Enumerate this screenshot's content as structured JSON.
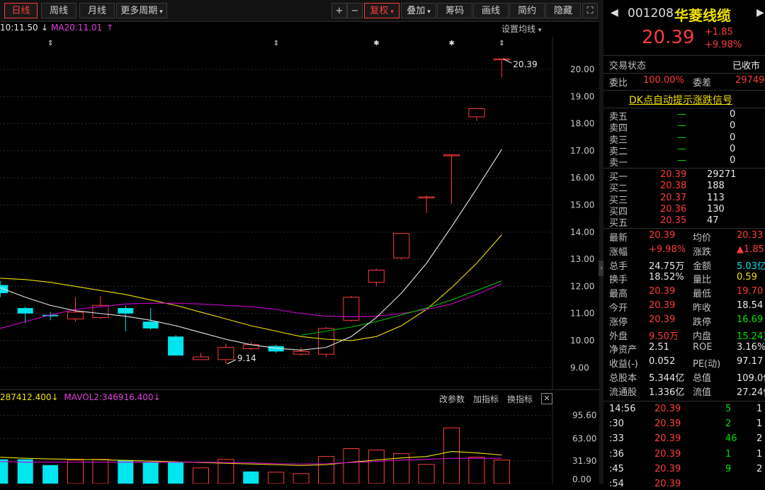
{
  "toolbar": {
    "tabs": [
      {
        "label": "日线",
        "active": true
      },
      {
        "label": "周线",
        "active": false
      },
      {
        "label": "月线",
        "active": false
      },
      {
        "label": "更多周期",
        "active": false
      }
    ],
    "right_buttons": [
      {
        "label": "+"
      },
      {
        "label": "−"
      },
      {
        "label": "复权",
        "active": true
      },
      {
        "label": "叠加"
      },
      {
        "label": "筹码"
      },
      {
        "label": "画线"
      },
      {
        "label": "简约"
      },
      {
        "label": "隐藏"
      }
    ]
  },
  "ma_legend": {
    "ma10": "10:11.50",
    "ma20": "MA20:11.01",
    "settings_label": "设置均线"
  },
  "vol_legend": {
    "mavol1": "287412.400",
    "mavol2": "MAVOL2:346916.400",
    "buttons": [
      "改参数",
      "加指标",
      "换指标"
    ]
  },
  "stock": {
    "code": "001208",
    "name": "华菱线缆",
    "price": "20.39",
    "change": "+1.85",
    "change_pct": "+9.98%"
  },
  "status": {
    "label": "交易状态",
    "value": "已收市"
  },
  "ratio": {
    "label1": "委比",
    "value1": "100.00%",
    "label2": "委差",
    "value2": "29749"
  },
  "signal_link": "DK点自动提示涨跌信号",
  "asks": [
    {
      "label": "卖五",
      "price": "—",
      "vol": "0"
    },
    {
      "label": "卖四",
      "price": "—",
      "vol": "0"
    },
    {
      "label": "卖三",
      "price": "—",
      "vol": "0"
    },
    {
      "label": "卖二",
      "price": "—",
      "vol": "0"
    },
    {
      "label": "卖一",
      "price": "—",
      "vol": "0"
    }
  ],
  "bids": [
    {
      "label": "买一",
      "price": "20.39",
      "vol": "29271"
    },
    {
      "label": "买二",
      "price": "20.38",
      "vol": "188"
    },
    {
      "label": "买三",
      "price": "20.37",
      "vol": "113"
    },
    {
      "label": "买四",
      "price": "20.36",
      "vol": "130"
    },
    {
      "label": "买五",
      "price": "20.35",
      "vol": "47"
    }
  ],
  "stats": [
    {
      "l1": "最新",
      "v1": "20.39",
      "c1": "red",
      "l2": "均价",
      "v2": "20.33",
      "c2": "red"
    },
    {
      "l1": "涨幅",
      "v1": "+9.98%",
      "c1": "red",
      "l2": "涨跌",
      "v2": "▲1.85",
      "c2": "red"
    },
    {
      "l1": "总手",
      "v1": "24.75万",
      "c1": "white",
      "l2": "金额",
      "v2": "5.03亿",
      "c2": "cyan"
    },
    {
      "l1": "换手",
      "v1": "18.52%",
      "c1": "white",
      "l2": "量比",
      "v2": "0.59",
      "c2": "yellow"
    },
    {
      "l1": "最高",
      "v1": "20.39",
      "c1": "red",
      "l2": "最低",
      "v2": "19.70",
      "c2": "red"
    },
    {
      "l1": "今开",
      "v1": "20.39",
      "c1": "red",
      "l2": "昨收",
      "v2": "18.54",
      "c2": "white"
    },
    {
      "l1": "涨停",
      "v1": "20.39",
      "c1": "red",
      "l2": "跌停",
      "v2": "16.69",
      "c2": "green"
    },
    {
      "l1": "外盘",
      "v1": "9.50万",
      "c1": "red",
      "l2": "内盘",
      "v2": "15.24万",
      "c2": "green"
    },
    {
      "l1": "净资产",
      "v1": "2.51",
      "c1": "white",
      "l2": "ROE",
      "v2": "3.16%",
      "c2": "white"
    },
    {
      "l1": "收益(-)",
      "v1": "0.052",
      "c1": "white",
      "l2": "PE(动)",
      "v2": "97.17",
      "c2": "white"
    },
    {
      "l1": "总股本",
      "v1": "5.344亿",
      "c1": "white",
      "l2": "总值",
      "v2": "109.0亿",
      "c2": "white"
    },
    {
      "l1": "流通股",
      "v1": "1.336亿",
      "c1": "white",
      "l2": "流值",
      "v2": "27.24亿",
      "c2": "white"
    }
  ],
  "ticks": [
    {
      "time": "14:56",
      "price": "20.39",
      "vol": "5",
      "n": "1"
    },
    {
      "time": ":30",
      "price": "20.39",
      "vol": "2",
      "n": "1"
    },
    {
      "time": ":33",
      "price": "20.39",
      "vol": "46",
      "n": "2"
    },
    {
      "time": ":36",
      "price": "20.39",
      "vol": "1",
      "n": "1"
    },
    {
      "time": ":45",
      "price": "20.39",
      "vol": "9",
      "n": "2"
    },
    {
      "time": ":54",
      "price": "20.39",
      "vol": "",
      "n": ""
    }
  ],
  "colors": {
    "up": "#ff3b3b",
    "down": "#00e5ee",
    "ma10": "#e8e8e8",
    "ma20": "#f0e000",
    "ma30": "#d000d0",
    "ma60": "#00c000"
  },
  "chart_data": [
    {
      "type": "candlestick",
      "y_ticks": [
        9.0,
        10.0,
        11.0,
        12.0,
        13.0,
        14.0,
        15.0,
        16.0,
        17.0,
        18.0,
        19.0,
        20.0
      ],
      "ylim": [
        8.2,
        21.2
      ],
      "annotations": {
        "high_label": "20.39",
        "low_label": "9.14"
      },
      "candles": [
        {
          "o": 12.05,
          "c": 11.75,
          "h": 12.2,
          "l": 11.6
        },
        {
          "o": 11.2,
          "c": 11.0,
          "h": 11.25,
          "l": 10.65
        },
        {
          "o": 10.95,
          "c": 10.9,
          "h": 11.05,
          "l": 10.75
        },
        {
          "o": 10.8,
          "c": 11.05,
          "h": 11.6,
          "l": 10.7
        },
        {
          "o": 10.85,
          "c": 11.3,
          "h": 11.65,
          "l": 10.8
        },
        {
          "o": 11.2,
          "c": 11.0,
          "h": 11.3,
          "l": 10.35
        },
        {
          "o": 10.7,
          "c": 10.45,
          "h": 11.2,
          "l": 10.4
        },
        {
          "o": 10.15,
          "c": 9.45,
          "h": 10.2,
          "l": 9.45
        },
        {
          "o": 9.3,
          "c": 9.4,
          "h": 9.55,
          "l": 9.3
        },
        {
          "o": 9.3,
          "c": 9.75,
          "h": 9.9,
          "l": 9.14
        },
        {
          "o": 9.7,
          "c": 9.85,
          "h": 9.95,
          "l": 9.65
        },
        {
          "o": 9.8,
          "c": 9.6,
          "h": 9.85,
          "l": 9.55
        },
        {
          "o": 9.5,
          "c": 9.6,
          "h": 9.75,
          "l": 9.45
        },
        {
          "o": 9.5,
          "c": 10.45,
          "h": 10.5,
          "l": 9.4
        },
        {
          "o": 10.75,
          "c": 11.6,
          "h": 11.65,
          "l": 10.7
        },
        {
          "o": 12.15,
          "c": 12.6,
          "h": 12.65,
          "l": 12.0
        },
        {
          "o": 13.05,
          "c": 13.95,
          "h": 13.95,
          "l": 13.0
        },
        {
          "o": 15.3,
          "c": 15.3,
          "h": 15.35,
          "l": 14.7
        },
        {
          "o": 16.85,
          "c": 16.85,
          "h": 16.85,
          "l": 15.05
        },
        {
          "o": 18.25,
          "c": 18.55,
          "h": 18.55,
          "l": 18.1
        },
        {
          "o": 20.39,
          "c": 20.39,
          "h": 20.39,
          "l": 19.7
        }
      ],
      "ma10": [
        11.95,
        11.6,
        11.3,
        11.1,
        11.0,
        10.9,
        10.75,
        10.55,
        10.3,
        10.05,
        9.85,
        9.72,
        9.65,
        9.75,
        10.15,
        10.85,
        11.75,
        12.85,
        14.2,
        15.6,
        17.05
      ],
      "ma20": [
        12.3,
        12.25,
        12.15,
        12.0,
        11.85,
        11.7,
        11.5,
        11.3,
        11.05,
        10.8,
        10.55,
        10.35,
        10.15,
        10.05,
        10.0,
        10.15,
        10.55,
        11.15,
        11.95,
        12.85,
        13.9
      ],
      "ma30": [
        10.45,
        10.7,
        10.95,
        11.15,
        11.25,
        11.35,
        11.38,
        11.38,
        11.35,
        11.3,
        11.25,
        11.15,
        11.0,
        10.9,
        10.88,
        10.9,
        11.0,
        11.15,
        11.35,
        11.7,
        12.1
      ],
      "ma60": [
        null,
        null,
        null,
        null,
        null,
        null,
        null,
        null,
        null,
        null,
        null,
        null,
        10.2,
        10.35,
        10.5,
        10.7,
        10.95,
        11.2,
        11.5,
        11.85,
        12.2
      ]
    },
    {
      "type": "bar",
      "y_ticks": [
        0.0,
        31.9,
        63.0,
        95.6
      ],
      "ylim": [
        0,
        110
      ],
      "volumes": [
        34,
        34,
        26,
        33,
        34,
        33,
        30,
        30,
        22,
        34,
        17,
        16,
        14,
        38,
        49,
        47,
        42,
        27,
        78,
        37,
        33
      ],
      "directions": [
        "down",
        "down",
        "down",
        "up",
        "up",
        "down",
        "down",
        "down",
        "up",
        "up",
        "down",
        "up",
        "up",
        "up",
        "up",
        "up",
        "up",
        "up",
        "up",
        "up",
        "up"
      ],
      "mavol1": [
        37,
        35.5,
        34.5,
        34,
        33.5,
        32.5,
        31.5,
        30.5,
        29.5,
        28.5,
        27.5,
        26.5,
        25.5,
        26.5,
        30,
        33,
        36,
        38,
        45,
        43,
        40
      ],
      "mavol2": [
        31,
        30,
        30,
        30,
        30,
        30,
        30,
        30,
        30,
        29.5,
        29,
        28,
        27.5,
        28,
        29.5,
        31,
        33,
        34,
        35.5,
        35.5,
        35.5
      ]
    }
  ]
}
